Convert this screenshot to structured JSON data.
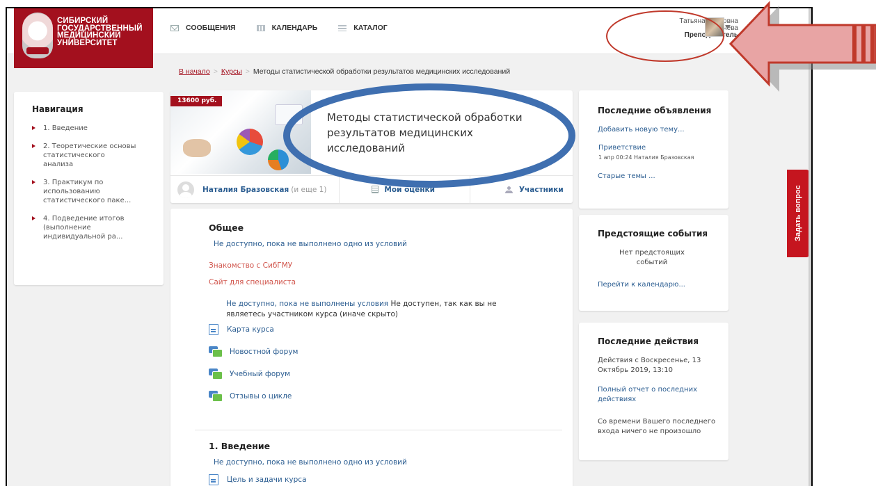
{
  "logo": {
    "lines": [
      "СИБИРСКИЙ",
      "ГОСУДАРСТВЕННЫЙ",
      "МЕДИЦИНСКИЙ",
      "УНИВЕРСИТЕТ"
    ]
  },
  "topnav": [
    {
      "label": "СООБЩЕНИЯ",
      "icon": "mail-icon"
    },
    {
      "label": "КАЛЕНДАРЬ",
      "icon": "calendar-icon"
    },
    {
      "label": "КАТАЛОГ",
      "icon": "catalog-icon"
    }
  ],
  "user": {
    "first_names": "Татьяна Петровна",
    "last_name": "Калачева",
    "role": "Преподаватель"
  },
  "breadcrumb": {
    "home": "В начало",
    "courses": "Курсы",
    "current": "Методы статистической обработки результатов медицинских исследований"
  },
  "navigation": {
    "title": "Навигация",
    "items": [
      "1. Введение",
      "2. Теоретические основы статистического анализа",
      "3. Практикум по использованию статистического паке...",
      "4. Подведение итогов (выполнение индивидуальной ра..."
    ]
  },
  "course": {
    "price": "13600 руб.",
    "title": "Методы статистической обработки результатов медицинских исследований",
    "teacher": "Наталия Бразовская",
    "teacher_more": "(и еще 1)",
    "grades_label": "Мои оценки",
    "participants_label": "Участники"
  },
  "content": {
    "general_title": "Общее",
    "not_available_one": "Не доступно, пока не выполнено одно из условий",
    "link_sibgmu": "Знакомство с СибГМУ",
    "link_specialists": "Сайт для специалиста",
    "restriction_blue": "Не доступно, пока не выполнены условия",
    "restriction_text": " Не доступен, так как вы не являетесь участником курса (иначе скрыто)",
    "activities": [
      {
        "label": "Карта курса",
        "icon": "page-icon"
      },
      {
        "label": "Новостной форум",
        "icon": "forum-icon"
      },
      {
        "label": "Учебный форум",
        "icon": "forum-icon"
      },
      {
        "label": "Отзывы о цикле",
        "icon": "forum-icon"
      }
    ],
    "section1_title": "1. Введение",
    "section1_not_available": "Не доступно, пока не выполнено одно из условий",
    "section1_activity": "Цель и задачи курса"
  },
  "announcements": {
    "title": "Последние объявления",
    "add": "Добавить новую тему...",
    "post_title": "Приветствие",
    "post_meta": "1 апр 00:24  Наталия Бразовская",
    "old": "Старые темы ..."
  },
  "events": {
    "title": "Предстоящие события",
    "none": "Нет предстоящих событий",
    "goto": "Перейти к календарю..."
  },
  "recent": {
    "title": "Последние действия",
    "since": "Действия с Воскресенье, 13 Октябрь 2019, 13:10",
    "report": "Полный отчет о последних действиях",
    "nothing": "Со времени Вашего последнего входа ничего не произошло"
  },
  "ask_tab": "Задать вопрос",
  "colors": {
    "brand": "#a3101e",
    "link": "#2b5d91",
    "annotation_ellipse": "#3f6fb0",
    "annotation_arrow": "#c0392b"
  }
}
